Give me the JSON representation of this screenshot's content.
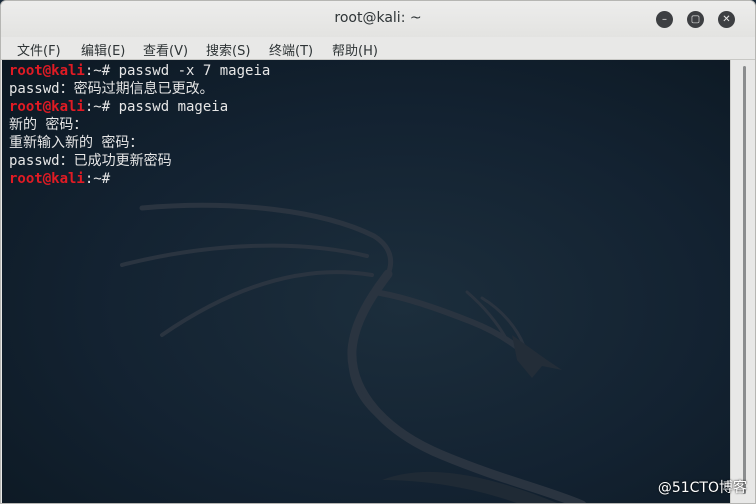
{
  "window": {
    "title": "root@kali: ~",
    "buttons": {
      "minimize": "minimize-icon",
      "maximize": "maximize-icon",
      "close": "close-icon"
    }
  },
  "menubar": {
    "items": [
      {
        "label": "文件(F)"
      },
      {
        "label": "编辑(E)"
      },
      {
        "label": "查看(V)"
      },
      {
        "label": "搜索(S)"
      },
      {
        "label": "终端(T)"
      },
      {
        "label": "帮助(H)"
      }
    ]
  },
  "terminal": {
    "prompt_user": "root@kali",
    "prompt_path": ":~# ",
    "lines": [
      {
        "type": "prompt",
        "command": "passwd -x 7 mageia"
      },
      {
        "type": "output",
        "text": "passwd：密码过期信息已更改。"
      },
      {
        "type": "prompt",
        "command": "passwd mageia"
      },
      {
        "type": "output",
        "text": "新的 密码："
      },
      {
        "type": "output",
        "text": "重新输入新的 密码："
      },
      {
        "type": "output",
        "text": "passwd：已成功更新密码"
      },
      {
        "type": "prompt",
        "command": ""
      }
    ]
  },
  "watermark": "@51CTO博客",
  "colors": {
    "prompt_user": "#e01b24",
    "terminal_bg": "#132231"
  }
}
